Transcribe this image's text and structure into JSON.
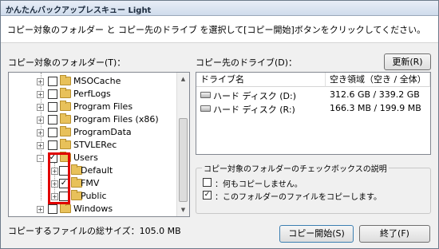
{
  "window": {
    "title": "かんたんバックアップレスキュー Light"
  },
  "instruction": "コピー対象のフォルダー と コピー先のドライブ を選択して[コピー開始]ボタンをクリックしてください。",
  "folders_panel": {
    "label": "コピー対象のフォルダー(T)：",
    "items": [
      {
        "label": "MSOCache",
        "expander": "+",
        "checked": false
      },
      {
        "label": "PerfLogs",
        "expander": "+",
        "checked": false
      },
      {
        "label": "Program Files",
        "expander": "+",
        "checked": false
      },
      {
        "label": "Program Files (x86)",
        "expander": "+",
        "checked": false
      },
      {
        "label": "ProgramData",
        "expander": "+",
        "checked": false
      },
      {
        "label": "STVLERec",
        "expander": "+",
        "checked": false
      },
      {
        "label": "Users",
        "expander": "-",
        "checked": true
      },
      {
        "label": "Default",
        "expander": "+",
        "checked": false
      },
      {
        "label": "FMV",
        "expander": "+",
        "checked": true
      },
      {
        "label": "Public",
        "expander": "+",
        "checked": false
      },
      {
        "label": "Windows",
        "expander": "+",
        "checked": false
      }
    ]
  },
  "drives_panel": {
    "label": "コピー先のドライブ(D)：",
    "refresh_button": "更新(R)",
    "columns": [
      "ドライブ名",
      "空き領域（空き / 全体）"
    ],
    "rows": [
      {
        "name": "ハード ディスク (D:)",
        "space": "312.6 GB / 339.2 GB"
      },
      {
        "name": "ハード ディスク (R:)",
        "space": "166.3 MB / 199.9 MB"
      }
    ]
  },
  "legend": {
    "title": "コピー対象のフォルダーのチェックボックスの説明",
    "items": [
      {
        "text": "：何もコピーしません。",
        "checked": false
      },
      {
        "text": "：このフォルダーのファイルをコピーします。",
        "checked": true
      }
    ]
  },
  "total_size": "コピーするファイルの総サイズ：105.0 MB",
  "buttons": {
    "start": "コピー開始(S)",
    "exit": "終了(F)"
  }
}
